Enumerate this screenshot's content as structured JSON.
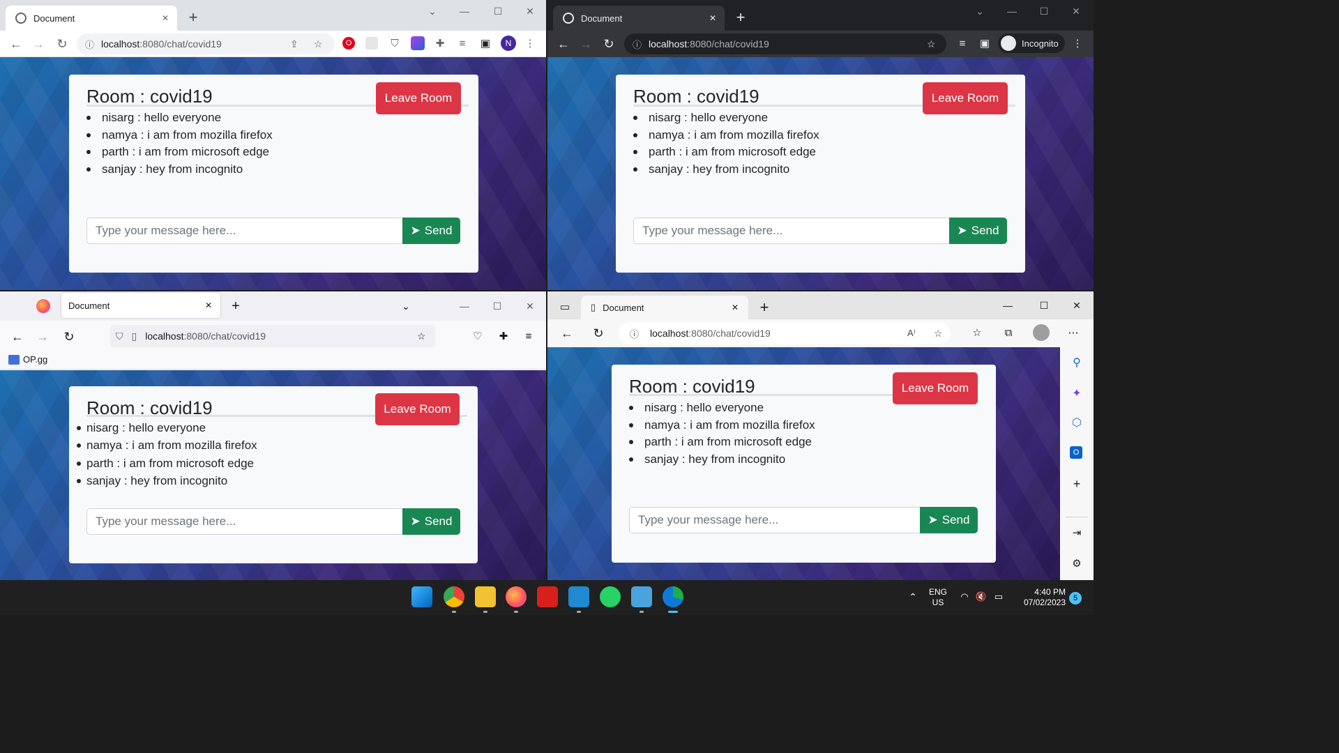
{
  "browser_common": {
    "tab_title": "Document",
    "url_host": "localhost",
    "url_path": ":8080/chat/covid19",
    "new_tab": "+",
    "close_tab": "✕"
  },
  "chrome": {
    "profile_initial": "N"
  },
  "chrome_incognito": {
    "incognito_label": "Incognito"
  },
  "firefox": {
    "bookmark_label": "OP.gg"
  },
  "chat": {
    "room_title": "Room : covid19",
    "leave_label": "Leave Room",
    "messages": [
      "nisarg : hello everyone",
      "namya : i am from mozilla firefox",
      "parth : i am from microsoft edge",
      "sanjay : hey from incognito"
    ],
    "input_placeholder": "Type your message here...",
    "send_label": "Send"
  },
  "taskbar": {
    "lang_line1": "ENG",
    "lang_line2": "US",
    "time": "4:40 PM",
    "date": "07/02/2023",
    "notification_count": "5"
  }
}
